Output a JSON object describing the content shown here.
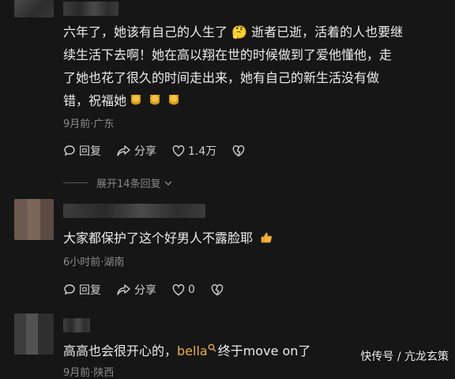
{
  "comments": [
    {
      "text_line1": "六年了，她该有自己的人生了 🤔 逝者已逝，活着的人也要继",
      "text_line2": "续生活下去啊！她在高以翔在世的时候做到了爱他懂他，走",
      "text_line3": "了她也花了很久的时间走出来，她有自己的新生活没有做",
      "text_line4": "错，祝福她",
      "meta": "9月前·广东",
      "reply_label": "回复",
      "share_label": "分享",
      "like_count": "1.4万",
      "expand_label": "展开14条回复"
    },
    {
      "text": "大家都保护了这个好男人不露脸耶",
      "meta": "6小时前·湖南",
      "reply_label": "回复",
      "share_label": "分享",
      "like_count": "0"
    },
    {
      "text_before": "高高也会很开心的，",
      "mention": "bella",
      "text_after": "终于move on了",
      "meta_partial": "9月前·陕西"
    }
  ],
  "watermark": "快传号 / 亢龙玄策",
  "colors": {
    "background": "#161616",
    "mention": "#e8b04a",
    "muted": "#8a8a8a"
  }
}
